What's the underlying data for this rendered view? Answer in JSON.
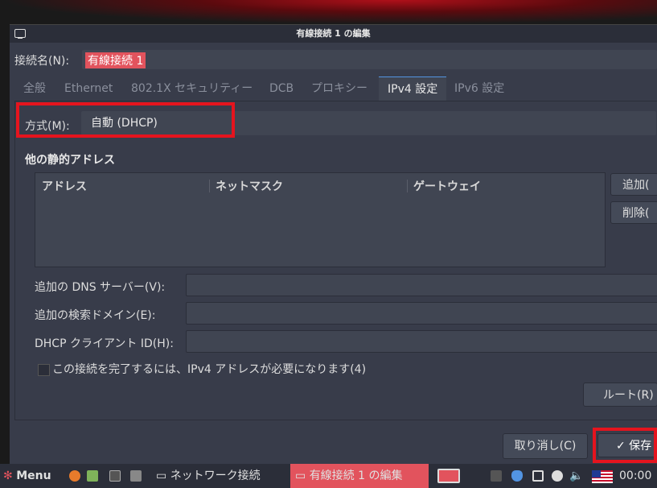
{
  "window": {
    "title": "有線接続 1 の編集"
  },
  "connection_name": {
    "label": "接続名(N):",
    "value": "有線接続 1"
  },
  "tabs": [
    {
      "label": "全般"
    },
    {
      "label": "Ethernet"
    },
    {
      "label": "802.1X セキュリティー"
    },
    {
      "label": "DCB"
    },
    {
      "label": "プロキシー"
    },
    {
      "label": "IPv4 設定"
    },
    {
      "label": "IPv6 設定"
    }
  ],
  "active_tab": "IPv4 設定",
  "method": {
    "label": "方式(M):",
    "value": "自動 (DHCP)"
  },
  "static_addresses": {
    "title": "他の静的アドレス",
    "columns": [
      "アドレス",
      "ネットマスク",
      "ゲートウェイ"
    ],
    "add_button": "追加(",
    "delete_button": "削除("
  },
  "fields": {
    "dns_label": "追加の DNS サーバー(V):",
    "search_domains_label": "追加の検索ドメイン(E):",
    "dhcp_client_id_label": "DHCP クライアント ID(H):"
  },
  "require_ipv4": {
    "label": "この接続を完了するには、IPv4 アドレスが必要になります(4)"
  },
  "route_button": "ルート(R)",
  "cancel_button": "取り消し(C)",
  "save_button": "✓ 保存",
  "taskbar": {
    "menu_label": "Menu",
    "tasks": [
      "ネットワーク接続",
      "有線接続 1 の編集"
    ],
    "clock": "00:00"
  },
  "colors": {
    "highlight": "#e5141e",
    "selection": "#e2535d",
    "accent": "#5294e2"
  }
}
